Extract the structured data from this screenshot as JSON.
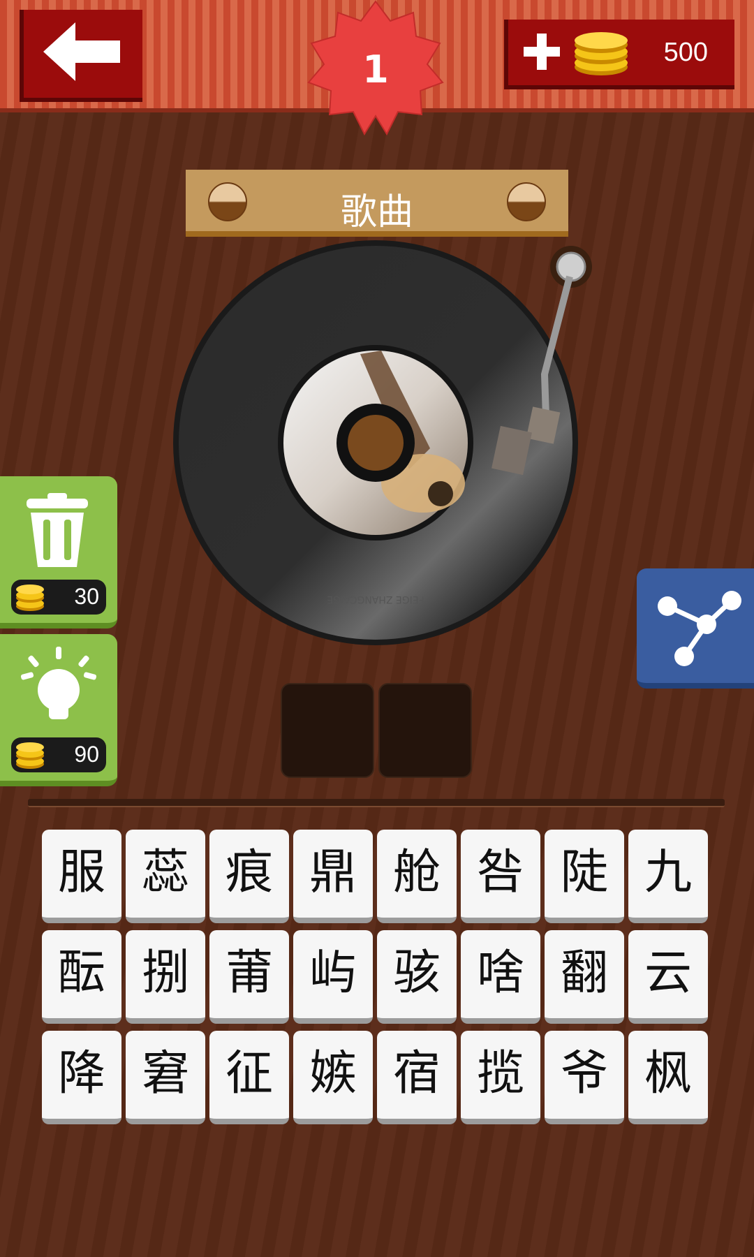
{
  "header": {
    "level": "1",
    "coins": "500"
  },
  "category": "歌曲",
  "record_label_text": "FEIGE ZHANGCAIGE",
  "side_buttons": {
    "remove_cost": "30",
    "hint_cost": "90"
  },
  "answer_slots": [
    "",
    ""
  ],
  "tiles": [
    [
      "服",
      "蕊",
      "痕",
      "鼎",
      "舱",
      "咎",
      "陡",
      "九"
    ],
    [
      "酝",
      "捌",
      "莆",
      "屿",
      "骇",
      "啥",
      "翻",
      "云"
    ],
    [
      "降",
      "窘",
      "征",
      "嫉",
      "宿",
      "揽",
      "爷",
      "枫"
    ]
  ],
  "colors": {
    "header_stripe": "#c9492f",
    "button_red": "#9b0c0c",
    "badge_red": "#e8403f",
    "green": "#8dc04a",
    "blue": "#3a5da0",
    "wood_bg": "#5a2a17"
  },
  "icons": {
    "back": "left-arrow-icon",
    "add": "plus-icon",
    "coins": "coin-stack-icon",
    "remove": "trash-icon",
    "hint": "lightbulb-icon",
    "share": "share-icon"
  }
}
